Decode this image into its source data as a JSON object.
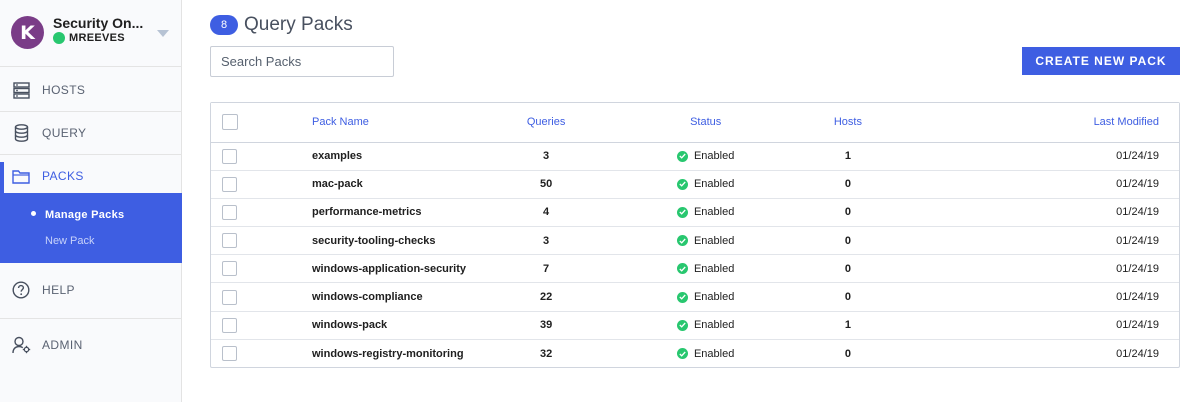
{
  "sidebar": {
    "org_name": "Security On...",
    "username": "MREEVES",
    "logo_letter": "K",
    "nav": {
      "hosts": "HOSTS",
      "query": "QUERY",
      "packs": "PACKS",
      "help": "HELP",
      "admin": "ADMIN"
    },
    "submenu": {
      "manage_packs": "Manage Packs",
      "new_pack": "New Pack"
    },
    "colors": {
      "accent": "#3e5ee2",
      "status_online": "#28c76f",
      "logo": "#7a3c87"
    }
  },
  "header": {
    "count": "8",
    "title": "Query Packs"
  },
  "search": {
    "placeholder": "Search Packs",
    "value": ""
  },
  "actions": {
    "create_label": "CREATE NEW PACK"
  },
  "table": {
    "columns": {
      "name": "Pack Name",
      "queries": "Queries",
      "status": "Status",
      "hosts": "Hosts",
      "modified": "Last Modified"
    },
    "rows": [
      {
        "name": "examples",
        "queries": "3",
        "status": "Enabled",
        "hosts": "1",
        "modified": "01/24/19"
      },
      {
        "name": "mac-pack",
        "queries": "50",
        "status": "Enabled",
        "hosts": "0",
        "modified": "01/24/19"
      },
      {
        "name": "performance-metrics",
        "queries": "4",
        "status": "Enabled",
        "hosts": "0",
        "modified": "01/24/19"
      },
      {
        "name": "security-tooling-checks",
        "queries": "3",
        "status": "Enabled",
        "hosts": "0",
        "modified": "01/24/19"
      },
      {
        "name": "windows-application-security",
        "queries": "7",
        "status": "Enabled",
        "hosts": "0",
        "modified": "01/24/19"
      },
      {
        "name": "windows-compliance",
        "queries": "22",
        "status": "Enabled",
        "hosts": "0",
        "modified": "01/24/19"
      },
      {
        "name": "windows-pack",
        "queries": "39",
        "status": "Enabled",
        "hosts": "1",
        "modified": "01/24/19"
      },
      {
        "name": "windows-registry-monitoring",
        "queries": "32",
        "status": "Enabled",
        "hosts": "0",
        "modified": "01/24/19"
      }
    ]
  }
}
